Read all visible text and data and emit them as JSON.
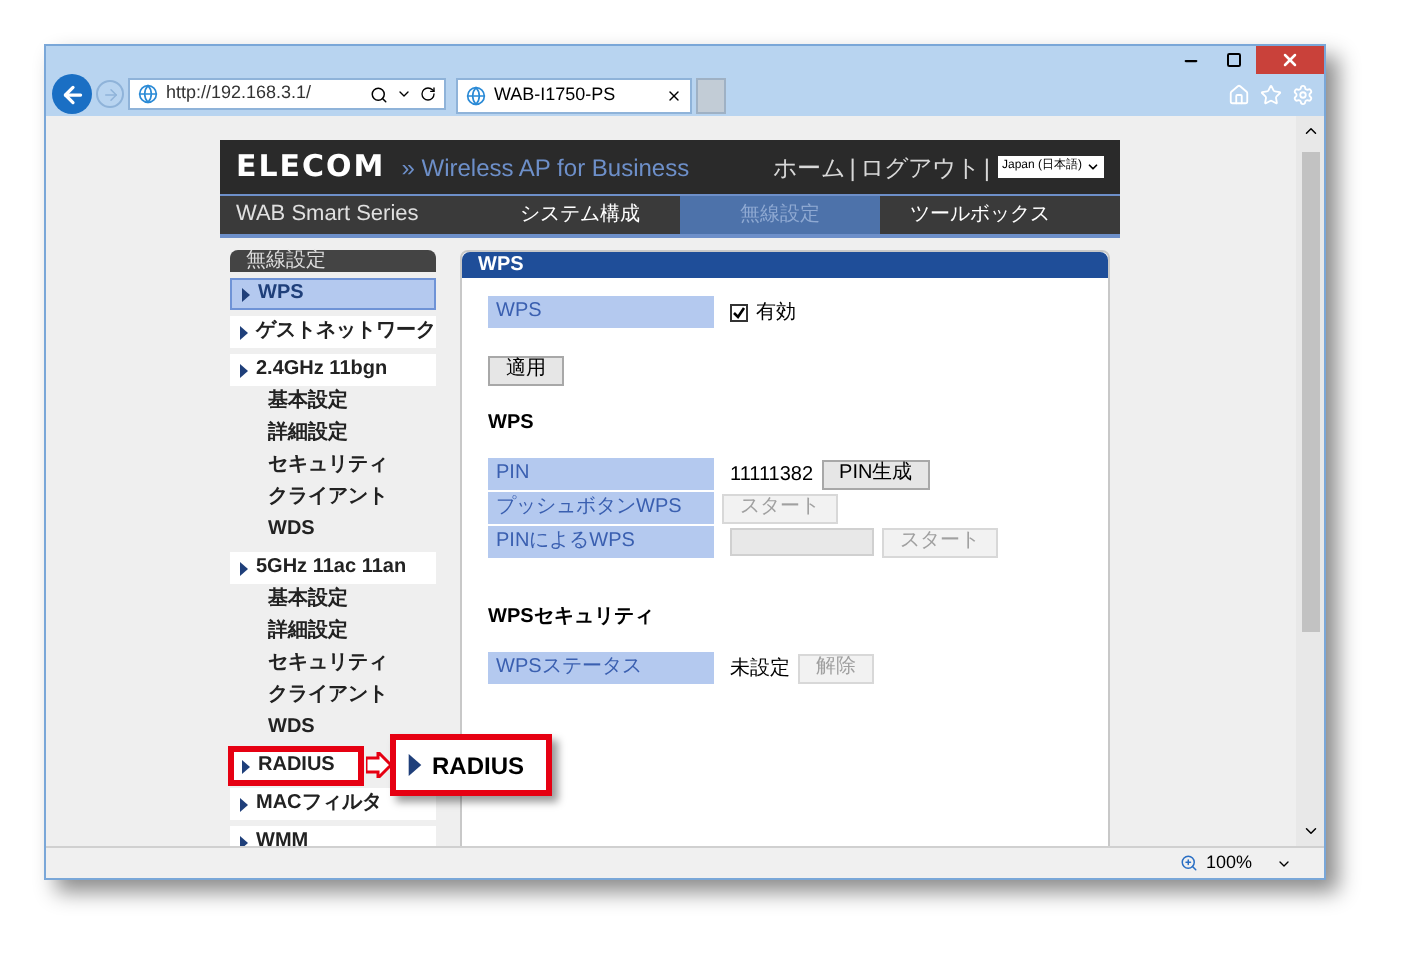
{
  "browser": {
    "address": "http://192.168.3.1/",
    "tab_title": "WAB-I1750-PS",
    "zoom": "100%"
  },
  "header": {
    "logo": "ELECOM",
    "tagline": "» Wireless AP for Business",
    "links": [
      "ホーム",
      "ログアウト"
    ],
    "separator": "|",
    "language": "Japan (日本語)",
    "series": "WAB Smart Series",
    "nav": [
      {
        "label": "システム構成",
        "selected": false
      },
      {
        "label": "無線設定",
        "selected": true
      },
      {
        "label": "ツールボックス",
        "selected": false
      }
    ]
  },
  "sidebar": {
    "heading": "無線設定",
    "items": [
      {
        "kind": "section",
        "label": "WPS",
        "selected": true,
        "annotated": false
      },
      {
        "kind": "section",
        "label": "ゲストネットワーク",
        "selected": false,
        "annotated": false
      },
      {
        "kind": "section",
        "label": "2.4GHz 11bgn",
        "selected": false,
        "annotated": false
      },
      {
        "kind": "sub",
        "label": "基本設定",
        "selected": false,
        "annotated": false
      },
      {
        "kind": "sub",
        "label": "詳細設定",
        "selected": false,
        "annotated": false
      },
      {
        "kind": "sub",
        "label": "セキュリティ",
        "selected": false,
        "annotated": false
      },
      {
        "kind": "sub",
        "label": "クライアント",
        "selected": false,
        "annotated": false
      },
      {
        "kind": "sub",
        "label": "WDS",
        "selected": false,
        "annotated": false
      },
      {
        "kind": "section",
        "label": "5GHz 11ac 11an",
        "selected": false,
        "annotated": false
      },
      {
        "kind": "sub",
        "label": "基本設定",
        "selected": false,
        "annotated": false
      },
      {
        "kind": "sub",
        "label": "詳細設定",
        "selected": false,
        "annotated": false
      },
      {
        "kind": "sub",
        "label": "セキュリティ",
        "selected": false,
        "annotated": false
      },
      {
        "kind": "sub",
        "label": "クライアント",
        "selected": false,
        "annotated": false
      },
      {
        "kind": "sub",
        "label": "WDS",
        "selected": false,
        "annotated": false
      },
      {
        "kind": "section",
        "label": "RADIUS",
        "selected": false,
        "annotated": true
      },
      {
        "kind": "section",
        "label": "MACフィルタ",
        "selected": false,
        "annotated": false
      },
      {
        "kind": "section",
        "label": "WMM",
        "selected": false,
        "annotated": false
      }
    ]
  },
  "callout": {
    "label": "RADIUS"
  },
  "panel": {
    "title": "WPS",
    "enable": {
      "label": "WPS",
      "checked": true,
      "option": "有効"
    },
    "apply_button": "適用",
    "wps_heading": "WPS",
    "wps_rows": [
      {
        "label": "PIN",
        "value": "11111382",
        "button": "PIN生成",
        "button_disabled": false
      },
      {
        "label": "プッシュボタンWPS",
        "button": "スタート",
        "button_disabled": true
      },
      {
        "label": "PINによるWPS",
        "input_disabled": true,
        "button": "スタート",
        "button_disabled": true
      }
    ],
    "security_heading": "WPSセキュリティ",
    "security_rows": [
      {
        "label": "WPSステータス",
        "value": "未設定",
        "button": "解除",
        "button_disabled": true
      }
    ]
  }
}
